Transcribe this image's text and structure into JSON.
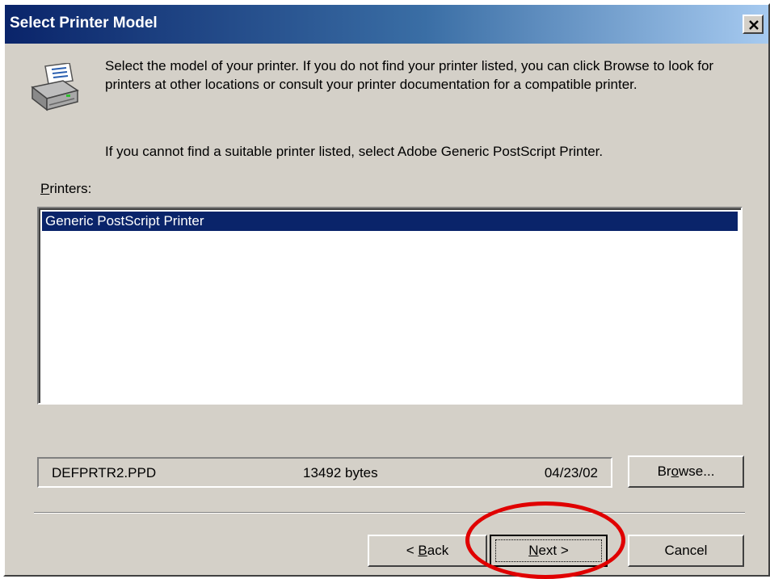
{
  "window": {
    "title": "Select Printer Model",
    "close_icon": "close-x"
  },
  "description": {
    "paragraph1": "Select the model of your printer. If you do not find your printer listed, you can click Browse to look for printers at other locations or consult your printer documentation for a compatible printer.",
    "paragraph2": "If you cannot find a suitable printer listed, select Adobe Generic PostScript Printer."
  },
  "printers": {
    "label_mnemonic": "P",
    "label_rest": "rinters:",
    "items": [
      "Generic PostScript Printer"
    ],
    "selected_index": 0
  },
  "file_info": {
    "filename": "DEFPRTR2.PPD",
    "size": "13492 bytes",
    "date": "04/23/02"
  },
  "buttons": {
    "browse": {
      "pre": "Br",
      "mnemonic": "o",
      "post": "wse..."
    },
    "back": {
      "pre": "< ",
      "mnemonic": "B",
      "post": "ack"
    },
    "next": {
      "pre": "",
      "mnemonic": "N",
      "post": "ext >"
    },
    "cancel": "Cancel"
  },
  "colors": {
    "dialog_bg": "#d4d0c8",
    "selection_bg": "#0a246a",
    "highlight_ring": "#e00000"
  }
}
